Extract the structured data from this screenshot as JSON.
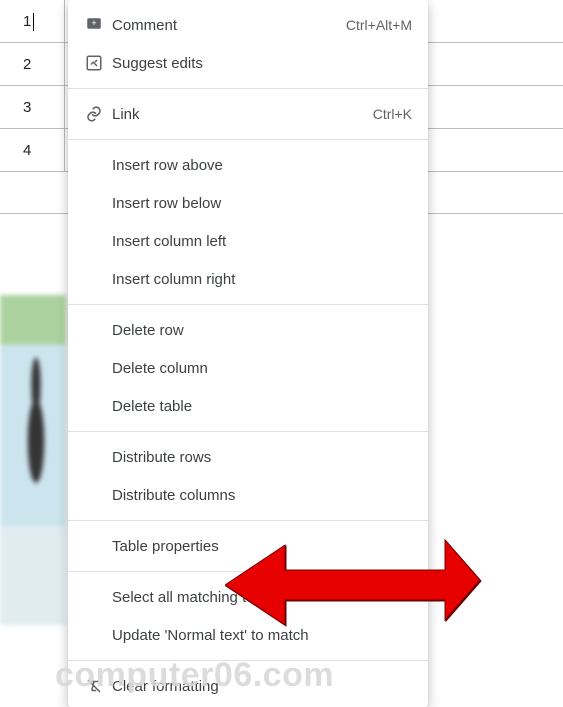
{
  "table_rows": [
    "1",
    "2",
    "3",
    "4"
  ],
  "menu": {
    "sections": [
      {
        "items": [
          {
            "icon": "comment",
            "label": "Comment",
            "shortcut": "Ctrl+Alt+M"
          },
          {
            "icon": "suggest",
            "label": "Suggest edits",
            "shortcut": ""
          }
        ]
      },
      {
        "items": [
          {
            "icon": "link",
            "label": "Link",
            "shortcut": "Ctrl+K"
          }
        ]
      },
      {
        "items": [
          {
            "icon": "",
            "label": "Insert row above",
            "shortcut": ""
          },
          {
            "icon": "",
            "label": "Insert row below",
            "shortcut": ""
          },
          {
            "icon": "",
            "label": "Insert column left",
            "shortcut": ""
          },
          {
            "icon": "",
            "label": "Insert column right",
            "shortcut": ""
          }
        ]
      },
      {
        "items": [
          {
            "icon": "",
            "label": "Delete row",
            "shortcut": ""
          },
          {
            "icon": "",
            "label": "Delete column",
            "shortcut": ""
          },
          {
            "icon": "",
            "label": "Delete table",
            "shortcut": ""
          }
        ]
      },
      {
        "items": [
          {
            "icon": "",
            "label": "Distribute rows",
            "shortcut": ""
          },
          {
            "icon": "",
            "label": "Distribute columns",
            "shortcut": ""
          }
        ]
      },
      {
        "items": [
          {
            "icon": "",
            "label": "Table properties",
            "shortcut": ""
          }
        ]
      },
      {
        "items": [
          {
            "icon": "",
            "label": "Select all matching text",
            "shortcut": ""
          },
          {
            "icon": "",
            "label": "Update 'Normal text' to match",
            "shortcut": ""
          }
        ]
      },
      {
        "items": [
          {
            "icon": "clear",
            "label": "Clear formatting",
            "shortcut": ""
          }
        ]
      }
    ]
  },
  "watermark": "computer06.com",
  "arrow_color": "#e60000"
}
